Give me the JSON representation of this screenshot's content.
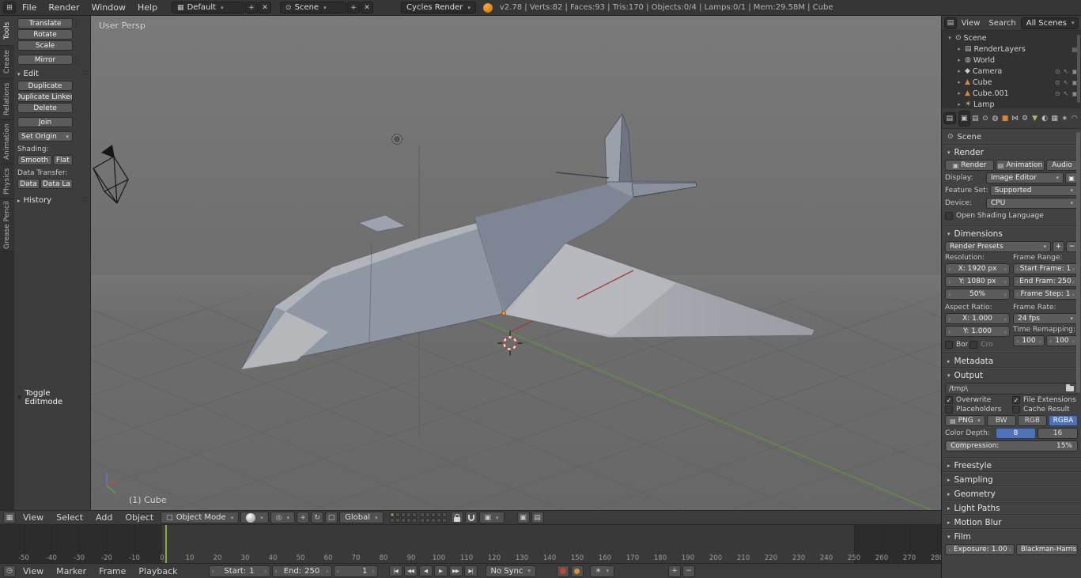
{
  "icons": {
    "check": "✓",
    "tri_open": "▼",
    "tri_closed": "▶",
    "tri_open_small": "▾",
    "tri_right_small": "▸",
    "scene": "⊙",
    "renderlayers": "▤",
    "world": "◍",
    "camera_obj": "◆",
    "mesh": "▲",
    "lamp": "☀",
    "restrict_view": "⊙",
    "restrict_select": "↖",
    "restrict_render": "▣",
    "editor_info": "⊞",
    "editor_3dview": "▦",
    "editor_outliner": "▤",
    "editor_properties": "▤",
    "editor_timeline": "◷",
    "tab_render": "▣",
    "tab_layers": "▤",
    "tab_scene": "⊙",
    "tab_world": "◍",
    "tab_object": "■",
    "tab_constraints": "⋈",
    "tab_modifiers": "⚙",
    "tab_data": "▼",
    "tab_material": "◐",
    "tab_texture": "▦",
    "tab_particles": "∗",
    "tab_physics": "◠",
    "mode_cube": "▢",
    "pivot": "◎",
    "manip_translate": "+",
    "manip_rotate": "↻",
    "manip_scale": "▢",
    "snap_element": "▣",
    "layout_icon": "▦",
    "scene_icon_small": "⊙",
    "plus": "+",
    "close": "✕",
    "render_still": "▣",
    "render_anim": "▤",
    "audio_icon": "∿",
    "image_format": "▤",
    "transport": [
      "|◀",
      "◀◀",
      "◀",
      "▶",
      "▶▶",
      "▶|"
    ],
    "keying_minus": "−",
    "keying_plus": "+"
  },
  "info_bar": {
    "menus": [
      "File",
      "Render",
      "Window",
      "Help"
    ],
    "layout_value": "Default",
    "scene_value": "Scene",
    "engine_value": "Cycles Render",
    "stats": "v2.78 | Verts:82 | Faces:93 | Tris:170 | Objects:0/4 | Lamps:0/1 | Mem:29.58M | Cube"
  },
  "tool_tabs": [
    "Tools",
    "Create",
    "Relations",
    "Animation",
    "Physics",
    "Grease Pencil"
  ],
  "tool_shelf": {
    "translate": "Translate",
    "rotate": "Rotate",
    "scale": "Scale",
    "mirror": "Mirror",
    "edit_title": "Edit",
    "duplicate": "Duplicate",
    "duplicate_linked": "Duplicate Linked",
    "delete": "Delete",
    "join": "Join",
    "set_origin": "Set Origin",
    "shading_label": "Shading:",
    "smooth": "Smooth",
    "flat": "Flat",
    "data_transfer_label": "Data Transfer:",
    "data": "Data",
    "data_layout": "Data La",
    "history_title": "History",
    "last_operator": "Toggle Editmode"
  },
  "viewport": {
    "view_label": "User Persp",
    "active_object_label": "(1) Cube"
  },
  "view3d_header": {
    "menus": [
      "View",
      "Select",
      "Add",
      "Object"
    ],
    "mode_value": "Object Mode",
    "orientation_value": "Global"
  },
  "timeline": {
    "menus": [
      "View",
      "Marker",
      "Frame",
      "Playback"
    ],
    "start_label": "Start:",
    "start_value": "1",
    "end_label": "End:",
    "end_value": "250",
    "current_frame": "1",
    "sync_value": "No Sync",
    "ruler": {
      "min": -50,
      "max": 280,
      "step": 10
    }
  },
  "outliner": {
    "menus": [
      "View",
      "Search"
    ],
    "display_mode": "All Scenes",
    "rows": [
      {
        "label": "Scene"
      },
      {
        "label": "RenderLayers"
      },
      {
        "label": "World"
      },
      {
        "label": "Camera"
      },
      {
        "label": "Cube"
      },
      {
        "label": "Cube.001"
      },
      {
        "label": "Lamp"
      }
    ]
  },
  "properties": {
    "context_label": "Scene",
    "render": {
      "title": "Render",
      "render_btn": "Render",
      "animation_btn": "Animation",
      "audio_btn": "Audio",
      "display_label": "Display:",
      "display_value": "Image Editor",
      "feature_label": "Feature Set:",
      "feature_value": "Supported",
      "device_label": "Device:",
      "device_value": "CPU",
      "osl_label": "Open Shading Language"
    },
    "dimensions": {
      "title": "Dimensions",
      "presets_value": "Render Presets",
      "resolution_label": "Resolution:",
      "res_x": "X: 1920 px",
      "res_y": "Y: 1080 px",
      "res_pct": "50%",
      "frame_range_label": "Frame Range:",
      "start_frame": "Start Frame: 1",
      "end_frame": "End Fram: 250",
      "frame_step": "Frame Step: 1",
      "aspect_label": "Aspect Ratio:",
      "aspect_x": "X: 1.000",
      "aspect_y": "Y: 1.000",
      "frame_rate_label": "Frame Rate:",
      "frame_rate_value": "24 fps",
      "remap_label": "Time Remapping:",
      "remap_a": "100",
      "remap_b": "100",
      "border_label": "Bor",
      "crop_label": "Cro"
    },
    "metadata_title": "Metadata",
    "output": {
      "title": "Output",
      "path_value": "/tmp\\",
      "overwrite_label": "Overwrite",
      "file_ext_label": "File Extensions",
      "placeholders_label": "Placeholders",
      "cache_label": "Cache Result",
      "format_value": "PNG",
      "bw_label": "BW",
      "rgb_label": "RGB",
      "rgba_label": "RGBA",
      "depth_label": "Color Depth:",
      "depth_8": "8",
      "depth_16": "16",
      "compression_label": "Compression:",
      "compression_value": "15%"
    },
    "collapsed": [
      "Freestyle",
      "Sampling",
      "Geometry",
      "Light Paths",
      "Motion Blur"
    ],
    "film": {
      "title": "Film",
      "exposure_label": "Exposure:",
      "exposure_value": "1.00",
      "filter_value": "Blackman-Harris"
    }
  }
}
